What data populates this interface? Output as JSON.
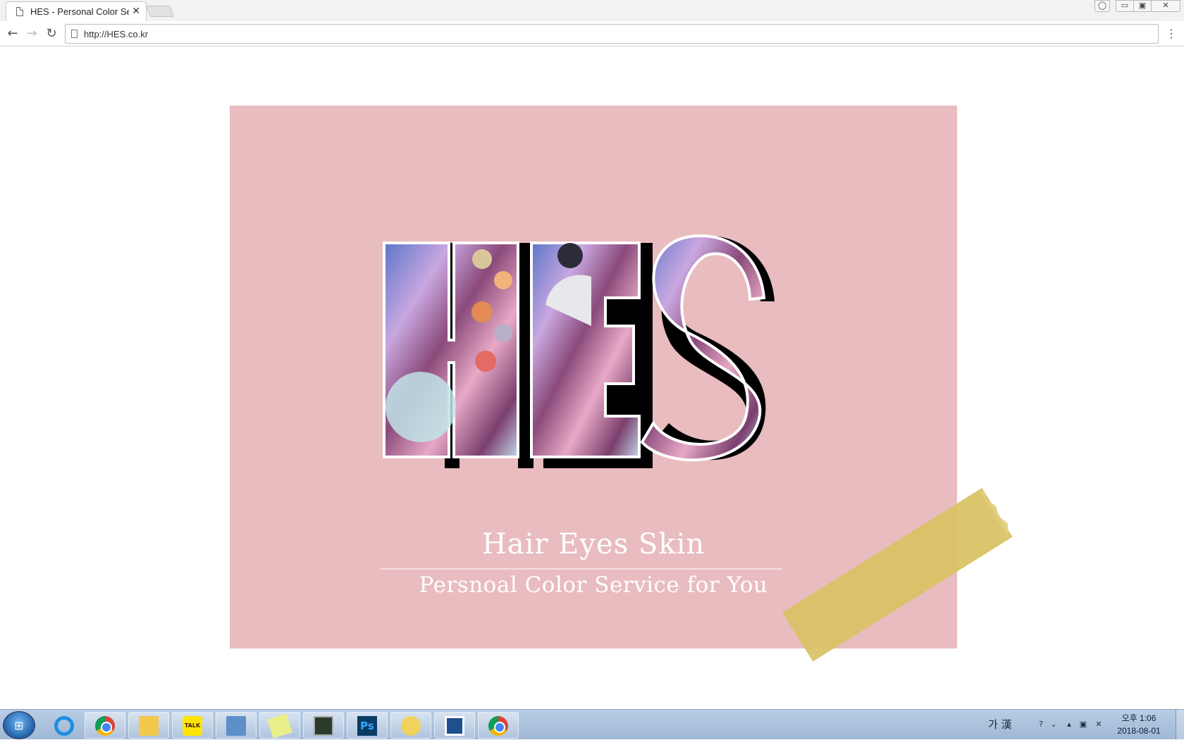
{
  "browser": {
    "tab": {
      "title": "HES - Personal Color Se",
      "close_glyph": "✕"
    },
    "toolbar": {
      "back_glyph": "←",
      "forward_glyph": "→",
      "reload_glyph": "↻",
      "url": "http://HES.co.kr",
      "menu_glyph": "⋮"
    },
    "window_controls": {
      "user_glyph": "◯",
      "minimize_glyph": "▭",
      "maximize_glyph": "▣",
      "close_glyph": "✕"
    }
  },
  "page": {
    "logo_text": "HES",
    "tagline_main": "Hair Eyes Skin",
    "tagline_sub": "Persnoal Color Service for You",
    "colors": {
      "hero_background": "#e9bcbf",
      "tape": "#d9c264",
      "text": "#ffffff"
    }
  },
  "taskbar": {
    "apps": [
      {
        "name": "internet-explorer-icon"
      },
      {
        "name": "chrome-icon"
      },
      {
        "name": "file-explorer-icon"
      },
      {
        "name": "kakaotalk-icon",
        "label": "TALK"
      },
      {
        "name": "remote-desktop-icon"
      },
      {
        "name": "sticky-notes-icon"
      },
      {
        "name": "monitor-app-icon"
      },
      {
        "name": "photoshop-icon",
        "label": "Ps"
      },
      {
        "name": "messenger-bird-icon"
      },
      {
        "name": "bracket-app-icon"
      },
      {
        "name": "chrome-icon"
      }
    ],
    "ime_text": "가 漢",
    "clock": {
      "time": "오후 1:06",
      "date": "2018-08-01"
    }
  }
}
